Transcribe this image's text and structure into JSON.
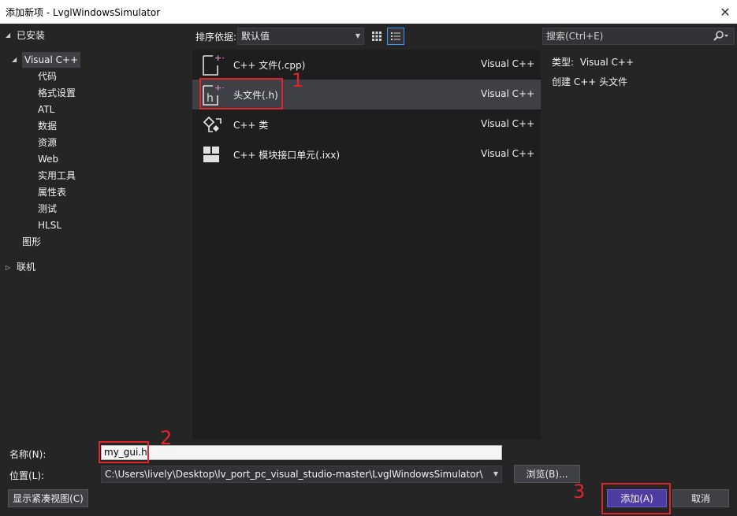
{
  "window": {
    "title": "添加新项 - LvglWindowsSimulator",
    "close_glyph": "✕"
  },
  "tree": {
    "installed": "已安装",
    "visual_cpp": "Visual C++",
    "children": [
      "代码",
      "格式设置",
      "ATL",
      "数据",
      "资源",
      "Web",
      "实用工具",
      "属性表",
      "测试",
      "HLSL"
    ],
    "graphics": "图形",
    "online": "联机"
  },
  "toolbar": {
    "sort_label": "排序依据:",
    "sort_value": "默认值"
  },
  "search": {
    "placeholder": "搜索(Ctrl+E)"
  },
  "templates": [
    {
      "name": "C++ 文件(.cpp)",
      "lang": "Visual C++",
      "icon": "cpp-file-icon"
    },
    {
      "name": "头文件(.h)",
      "lang": "Visual C++",
      "icon": "header-file-icon"
    },
    {
      "name": "C++ 类",
      "lang": "Visual C++",
      "icon": "cpp-class-icon"
    },
    {
      "name": "C++ 模块接口单元(.ixx)",
      "lang": "Visual C++",
      "icon": "module-unit-icon"
    }
  ],
  "description": {
    "type_label": "类型:",
    "type_value": "Visual C++",
    "text": "创建 C++ 头文件"
  },
  "form": {
    "name_label": "名称(N):",
    "name_value": "my_gui.h",
    "location_label": "位置(L):",
    "location_value": "C:\\Users\\lively\\Desktop\\lv_port_pc_visual_studio-master\\LvglWindowsSimulator\\",
    "browse": "浏览(B)...",
    "compact_view": "显示紧凑视图(C)",
    "add": "添加(A)",
    "cancel": "取消"
  },
  "annotations": [
    "1",
    "2",
    "3"
  ],
  "colors": {
    "accent": "#3399ff",
    "primary_button": "#4e3ca0",
    "annotation_red": "#e0242b"
  }
}
